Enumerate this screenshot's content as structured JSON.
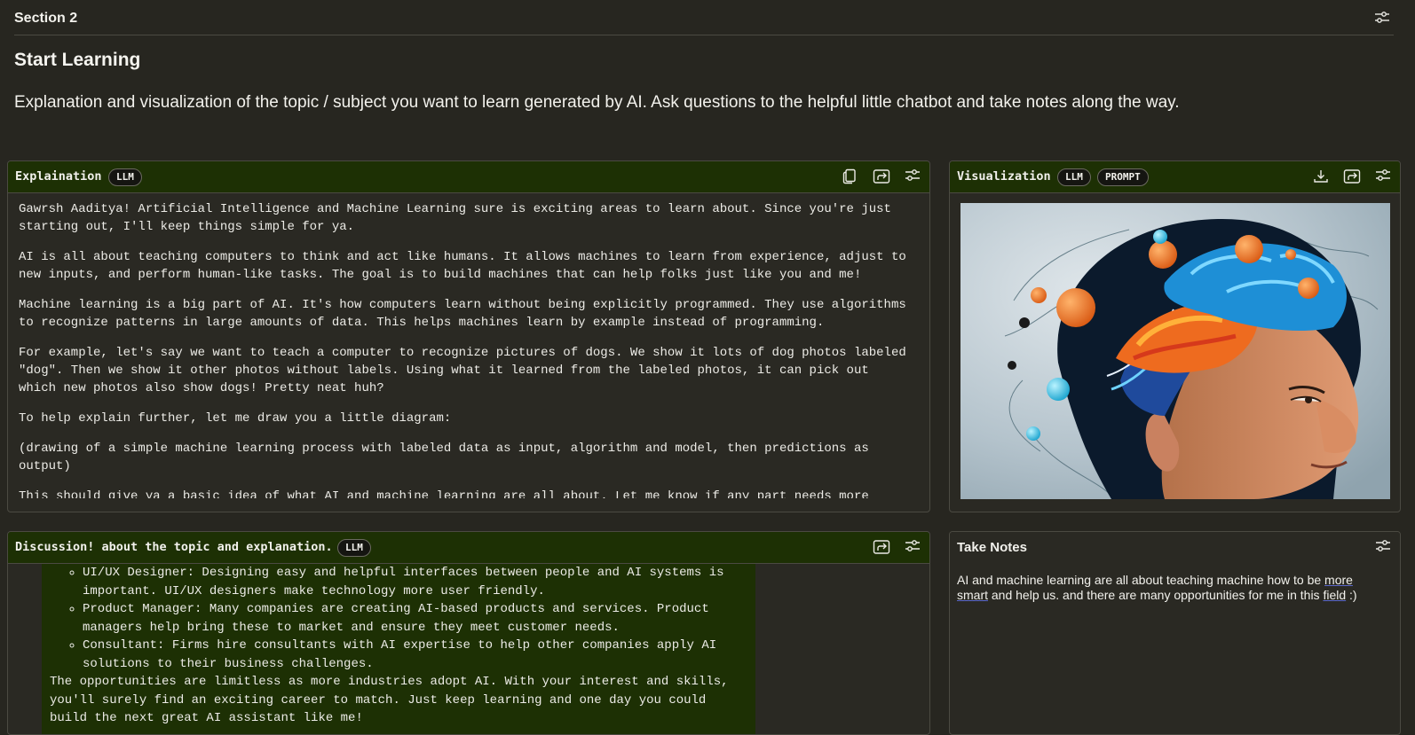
{
  "section": {
    "title": "Section 2"
  },
  "page": {
    "title": "Start Learning",
    "description": "Explanation and visualization of the topic / subject you want to learn generated by AI. Ask questions to the helpful little chatbot and take notes along the way."
  },
  "explanation": {
    "title": "Explaination",
    "badge": "LLM",
    "paragraphs": [
      "Gawrsh Aaditya! Artificial Intelligence and Machine Learning sure is exciting areas to learn about. Since you're just starting out, I'll keep things simple for ya.",
      "AI is all about teaching computers to think and act like humans. It allows machines to learn from experience, adjust to new inputs, and perform human-like tasks. The goal is to build machines that can help folks just like you and me!",
      "Machine learning is a big part of AI. It's how computers learn without being explicitly programmed. They use algorithms to recognize patterns in large amounts of data. This helps machines learn by example instead of programming.",
      "For example, let's say we want to teach a computer to recognize pictures of dogs. We show it lots of dog photos labeled \"dog\". Then we show it other photos without labels. Using what it learned from the labeled photos, it can pick out which new photos also show dogs! Pretty neat huh?",
      "To help explain further, let me draw you a little diagram:",
      "(drawing of a simple machine learning process with labeled data as input, algorithm and model, then predictions as output)",
      "This should give ya a basic idea of what AI and machine learning are all about. Let me know if any part needs more"
    ]
  },
  "visualization": {
    "title": "Visualization",
    "badges": [
      "LLM",
      "PROMPT"
    ]
  },
  "discussion": {
    "title": "Discussion! about the topic and explanation.",
    "badge": "LLM",
    "items": [
      "UI/UX Designer: Designing easy and helpful interfaces between people and AI systems is important. UI/UX designers make technology more user friendly.",
      "Product Manager: Many companies are creating AI-based products and services. Product managers help bring these to market and ensure they meet customer needs.",
      "Consultant: Firms hire consultants with AI expertise to help other companies apply AI solutions to their business challenges."
    ],
    "outro": "The opportunities are limitless as more industries adopt AI. With your interest and skills, you'll surely find an exciting career to match. Just keep learning and one day you could build the next great AI assistant like me!"
  },
  "notes": {
    "title": "Take Notes",
    "t1": "AI and machine learning are all about teaching machine how to be ",
    "t2": "more smart",
    "t3": " and help us. and there are many opportunities for me in this ",
    "t4": "field",
    "t5": " :)"
  },
  "icons": {
    "settings": "sliders-icon",
    "copy": "copy-icon",
    "share": "share-icon",
    "download": "download-icon"
  },
  "colors": {
    "background": "#272620",
    "panel_header": "#1d3004",
    "text": "#ecebe6"
  }
}
